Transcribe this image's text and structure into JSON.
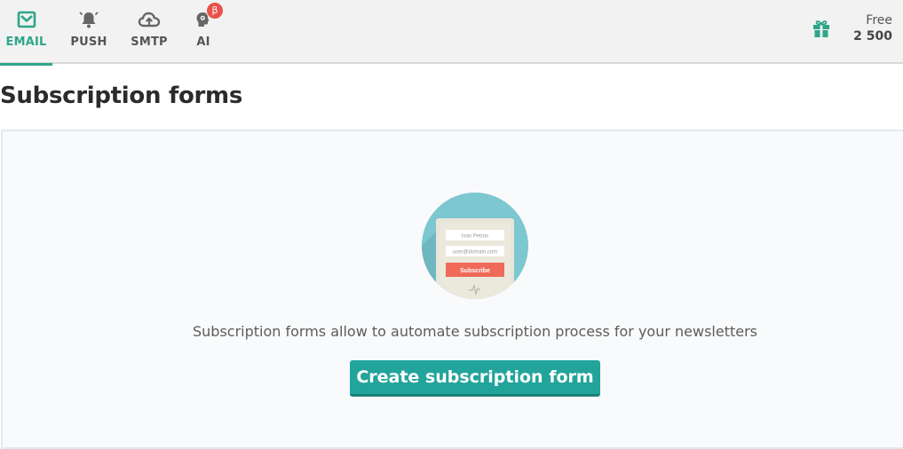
{
  "nav": {
    "tabs": [
      {
        "label": "EMAIL",
        "icon": "envelope-icon",
        "active": true
      },
      {
        "label": "PUSH",
        "icon": "bell-icon",
        "active": false
      },
      {
        "label": "SMTP",
        "icon": "cloud-upload-icon",
        "active": false
      },
      {
        "label": "AI",
        "icon": "head-gear-icon",
        "badge": "β",
        "active": false
      }
    ],
    "gift_icon": "gift-icon",
    "plan": {
      "name": "Free",
      "count": "2 500"
    }
  },
  "page": {
    "title": "Subscription forms"
  },
  "empty_state": {
    "illustration": {
      "name_field": "Ivan Petrov",
      "email_field": "user@domain.com",
      "subscribe_button": "Subscribe"
    },
    "description": "Subscription forms allow to automate subscription process for your newsletters",
    "cta_label": "Create subscription form"
  },
  "colors": {
    "accent": "#2fa58a",
    "cta": "#23a49b",
    "badge": "#e8534a",
    "illustration_bg": "#7cc7d0",
    "subscribe_btn": "#ef6a58"
  }
}
